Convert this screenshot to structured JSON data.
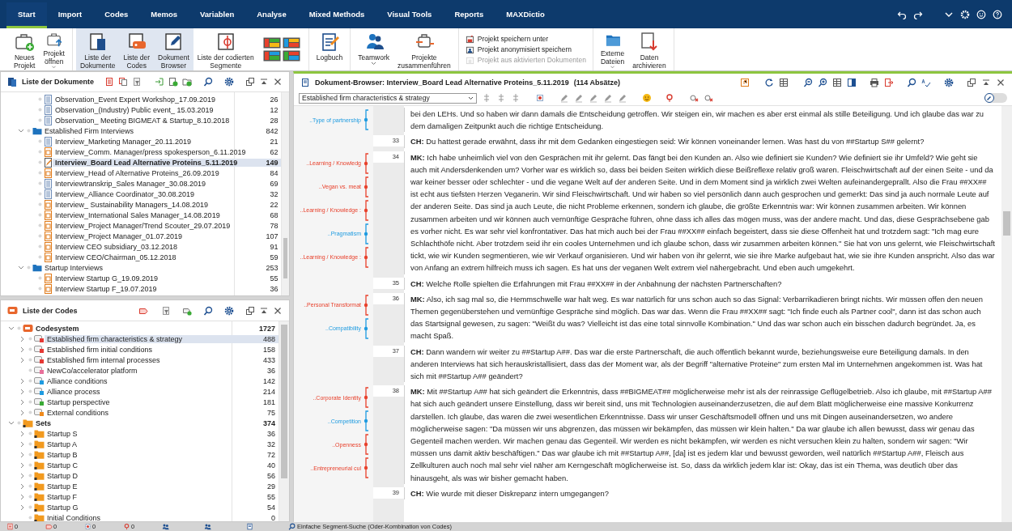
{
  "menu_tabs": [
    {
      "label": "Start",
      "selected": true
    },
    {
      "label": "Import",
      "selected": false
    },
    {
      "label": "Codes",
      "selected": false
    },
    {
      "label": "Memos",
      "selected": false
    },
    {
      "label": "Variablen",
      "selected": false
    },
    {
      "label": "Analyse",
      "selected": false
    },
    {
      "label": "Mixed Methods",
      "selected": false
    },
    {
      "label": "Visual Tools",
      "selected": false
    },
    {
      "label": "Reports",
      "selected": false
    },
    {
      "label": "MAXDictio",
      "selected": false
    }
  ],
  "ribbon": [
    [
      {
        "kind": "large",
        "label": "Neues\nProjekt",
        "dropdown": false,
        "selected": false
      },
      {
        "kind": "large",
        "label": "Projekt\nöffnen",
        "dropdown": true,
        "selected": false
      }
    ],
    [
      {
        "kind": "large",
        "label": "Liste der\nDokumente",
        "dropdown": false,
        "selected": true
      },
      {
        "kind": "large",
        "label": "Liste der\nCodes",
        "dropdown": false,
        "selected": true
      },
      {
        "kind": "large",
        "label": "Dokument\nBrowser",
        "dropdown": false,
        "selected": true
      },
      {
        "kind": "large",
        "label": "Liste der codierten\nSegmente",
        "dropdown": false,
        "selected": false
      },
      {
        "kind": "layouts"
      }
    ],
    [
      {
        "kind": "large",
        "label": "Logbuch",
        "dropdown": false,
        "selected": false
      }
    ],
    [
      {
        "kind": "large",
        "label": "Teamwork",
        "dropdown": true,
        "selected": false
      },
      {
        "kind": "large",
        "label": "Projekte\nzusammenführen",
        "dropdown": false,
        "selected": false
      }
    ],
    [
      {
        "kind": "small",
        "label": "Projekt speichern unter",
        "disabled": false
      },
      {
        "kind": "small",
        "label": "Projekt anonymisiert speichern",
        "disabled": false
      },
      {
        "kind": "small",
        "label": "Projekt aus aktivierten Dokumenten",
        "disabled": true
      }
    ],
    [
      {
        "kind": "large",
        "label": "Externe\nDateien",
        "dropdown": true,
        "selected": false
      },
      {
        "kind": "large",
        "label": "Daten\narchivieren",
        "dropdown": false,
        "selected": false
      }
    ]
  ],
  "documents_panel": {
    "title": "Liste der Dokumente",
    "tree": [
      {
        "children": [
          {
            "name": "Observation_Event Expert Workshop_17.09.2019",
            "kind": "text",
            "count": "26",
            "selected": false
          },
          {
            "name": "Observation_(Industry) Public event_ 15.03.2019",
            "kind": "text",
            "count": "12",
            "selected": false
          },
          {
            "name": "Observation_ Meeting BIGMEAT & Startup_8.10.2018",
            "kind": "text",
            "count": "28",
            "selected": false
          }
        ]
      },
      {
        "name": "Established Firm Interviews",
        "kind": "folder",
        "count": "842",
        "expanded": true,
        "selected": false,
        "children": [
          {
            "name": "Interview_Marketing Manager_20.11.2019",
            "kind": "text",
            "count": "21",
            "selected": false
          },
          {
            "name": "Interview_Comm. Manager/press spokesperson_6.11.2019",
            "kind": "media",
            "count": "62",
            "selected": false
          },
          {
            "name": "Interview_Board Lead Alternative Proteins_5.11.2019",
            "kind": "open",
            "count": "149",
            "selected": true
          },
          {
            "name": "Interview_Head of Alternative Proteins_26.09.2019",
            "kind": "media",
            "count": "84",
            "selected": false
          },
          {
            "name": "Interviewtranskrip_Sales Manager_30.08.2019",
            "kind": "text",
            "count": "69",
            "selected": false
          },
          {
            "name": "Interview_Alliance Coordinator_30.08.2019",
            "kind": "text",
            "count": "32",
            "selected": false
          },
          {
            "name": "Interview_ Sustainability Managers_14.08.2019",
            "kind": "media",
            "count": "22",
            "selected": false
          },
          {
            "name": "Interview_International Sales Manager_14.08.2019",
            "kind": "media",
            "count": "68",
            "selected": false
          },
          {
            "name": "Interview_Project Manager/Trend Scouter_29.07.2019",
            "kind": "media",
            "count": "78",
            "selected": false
          },
          {
            "name": "Interview_Project Manager_01.07.2019",
            "kind": "media",
            "count": "107",
            "selected": false
          },
          {
            "name": "Interview CEO subsidiary_03.12.2018",
            "kind": "media",
            "count": "91",
            "selected": false
          },
          {
            "name": "Interview CEO/Chairman_05.12.2018",
            "kind": "media",
            "count": "59",
            "selected": false
          }
        ]
      },
      {
        "name": "Startup Interviews",
        "kind": "folder",
        "count": "253",
        "expanded": true,
        "selected": false,
        "children": [
          {
            "name": "Interview Startup G_19.09.2019",
            "kind": "media",
            "count": "55",
            "selected": false
          },
          {
            "name": "Interview Startup F_19.07.2019",
            "kind": "media",
            "count": "36",
            "selected": false
          }
        ]
      }
    ]
  },
  "codes_panel": {
    "title": "Liste der Codes",
    "tree": [
      {
        "name": "Codesystem",
        "kind": "root",
        "count": "1727",
        "expanded": true,
        "selected": false,
        "children": [
          {
            "name": "Established firm characteristics & strategy",
            "kind": "code",
            "color": "#e53935",
            "count": "488",
            "expandable": true,
            "selected": true
          },
          {
            "name": "Established firm initial conditions",
            "kind": "code",
            "color": "#e53935",
            "count": "158",
            "expandable": true,
            "selected": false
          },
          {
            "name": "Established firm internal processes",
            "kind": "code",
            "color": "#e53935",
            "count": "433",
            "expandable": true,
            "selected": false
          },
          {
            "name": "NewCo/accelerator platform",
            "kind": "code",
            "color": "#e8709a",
            "count": "36",
            "expandable": false,
            "selected": false
          },
          {
            "name": "Alliance conditions",
            "kind": "code",
            "color": "#1e9be0",
            "count": "142",
            "expandable": true,
            "selected": false
          },
          {
            "name": "Alliance process",
            "kind": "code",
            "color": "#1e9be0",
            "count": "214",
            "expandable": true,
            "selected": false
          },
          {
            "name": "Startup perspective",
            "kind": "code",
            "color": "#3aaa35",
            "count": "181",
            "expandable": true,
            "selected": false
          },
          {
            "name": "External conditions",
            "kind": "code",
            "color": "#f08a1c",
            "count": "75",
            "expandable": true,
            "selected": false
          }
        ]
      },
      {
        "name": "Sets",
        "kind": "sets",
        "count": "374",
        "expanded": true,
        "selected": false,
        "children": [
          {
            "name": "Startup S",
            "kind": "set",
            "count": "36",
            "expandable": true,
            "selected": false
          },
          {
            "name": "Startup A",
            "kind": "set",
            "count": "32",
            "expandable": true,
            "selected": false
          },
          {
            "name": "Startup B",
            "kind": "set",
            "count": "72",
            "expandable": true,
            "selected": false
          },
          {
            "name": "Startup C",
            "kind": "set",
            "count": "40",
            "expandable": true,
            "selected": false
          },
          {
            "name": "Startup D",
            "kind": "set",
            "count": "56",
            "expandable": true,
            "selected": false
          },
          {
            "name": "Startup E",
            "kind": "set",
            "count": "29",
            "expandable": true,
            "selected": false
          },
          {
            "name": "Startup F",
            "kind": "set",
            "count": "55",
            "expandable": true,
            "selected": false
          },
          {
            "name": "Startup G",
            "kind": "set",
            "count": "54",
            "expandable": true,
            "selected": false
          },
          {
            "name": "Initial Conditions",
            "kind": "set",
            "count": "0",
            "expandable": false,
            "selected": false
          }
        ]
      }
    ]
  },
  "browser": {
    "title": "Dokument-Browser: Interview_Board Lead Alternative Proteins_5.11.2019",
    "paragraph_count": "(114 Absätze)",
    "code_filter": "Established firm characteristics & strategy",
    "paragraphs": [
      {
        "text": "bei den LEHs. Und so haben wir dann damals die Entscheidung getroffen. Wir steigen ein, wir machen es aber erst einmal als stille Beteiligung. Und ich glaube das war zu dem damaligen Zeitpunkt auch die richtige Entscheidung.",
        "codes": [
          {
            "label": "..Type of partnership",
            "color": "#1e9be0"
          }
        ]
      },
      {
        "number": "33",
        "text": "**CH:** Du hattest gerade erwähnt, dass ihr mit dem Gedanken eingestiegen seid: Wir können voneinander lernen. Was hast du von ##Startup S## gelernt?"
      },
      {
        "number": "34",
        "text": "**MK:** Ich habe unheimlich viel von den Gesprächen mit ihr gelernt. Das fängt bei den Kunden an. Also wie definiert sie Kunden? Wie definiert sie ihr Umfeld? Wie geht sie auch mit Andersdenkenden um? Vorher war es wirklich so, dass bei beiden Seiten wirklich diese Beißreflexe relativ groß waren. Fleischwirtschaft auf der einen Seite - und da war keiner besser oder schlechter - und die vegane Welt auf der anderen Seite. Und in dem Moment sind ja wirklich zwei Welten aufeinandergeprallt. Also die Frau ##XX## ist echt aus tiefsten Herzen Veganerin. Wir sind Fleischwirtschaft. Und wir haben so viel persönlich dann auch gesprochen und gemerkt: Das sind ja auch normale Leute auf der anderen Seite. Das sind ja auch Leute, die nicht Probleme erkennen, sondern ich glaube, die größte Erkenntnis war: Wir können zusammen arbeiten. Wir können zusammen arbeiten und wir können auch vernünftige Gespräche führen, ohne dass ich alles das mögen muss, was der andere macht. Und das, diese Gesprächsebene gab es vorher nicht. Es war sehr viel konfrontativer. Das hat mich auch bei der Frau ##XX## einfach begeistert, dass sie diese Offenheit hat und trotzdem sagt: \"Ich mag eure Schlachthöfe nicht. Aber trotzdem seid ihr ein cooles Unternehmen und ich glaube schon, dass wir zusammen arbeiten können.\" Sie hat von uns gelernt, wie Fleischwirtschaft tickt, wie wir Kunden segmentieren, wie wir Verkauf organisieren. Und wir haben von ihr gelernt, wie sie ihre Marke aufgebaut hat, wie sie ihre Kunden anspricht. Also das war von Anfang an extrem hilfreich muss ich sagen. Es hat uns der veganen Welt extrem viel nähergebracht. Und eben auch umgekehrt.",
        "codes": [
          {
            "label": "..Learning / Knowledg",
            "color": "#e8412c"
          },
          {
            "label": "..Vegan vs. meat",
            "color": "#e8412c"
          },
          {
            "label": "..Learning / Knowledge :",
            "color": "#e8412c"
          },
          {
            "label": "..Pragmatism",
            "color": "#1e9be0"
          },
          {
            "label": "..Learning / Knowledge :",
            "color": "#e8412c"
          }
        ]
      },
      {
        "number": "35",
        "text": "**CH:** Welche Rolle spielten die Erfahrungen mit Frau ##XX## in der Anbahnung der nächsten Partnerschaften?"
      },
      {
        "number": "36",
        "text": "**MK:** Also, ich sag mal so, die Hemmschwelle war halt weg. Es war natürlich für uns schon auch so das Signal: Verbarrikadieren bringt nichts. Wir müssen offen den neuen Themen gegenüberstehen und vernünftige Gespräche sind möglich. Das war das. Wenn die Frau ##XX## sagt: \"Ich finde euch als Partner cool\", dann ist das schon auch das Startsignal gewesen, zu sagen: \"Weißt du was? Vielleicht ist das eine total sinnvolle Kombination.\" Und das war schon auch ein bisschen dadurch begründet. Ja, es macht Spaß.",
        "codes": [
          {
            "label": "..Personal Transformat",
            "color": "#e8412c"
          },
          {
            "label": "..Compatibility",
            "color": "#1e9be0"
          }
        ]
      },
      {
        "number": "37",
        "text": "**CH:** Dann wandern wir weiter zu ##Startup A##. Das war die erste Partnerschaft, die auch öffentlich bekannt wurde, beziehungsweise eure Beteiligung damals. In den anderen Interviews hat sich herauskristallisiert, dass das der Moment war, als der Begriff \"alternative Proteine\" zum ersten Mal im Unternehmen angekommen ist. Was hat sich mit ##Startup A## geändert?"
      },
      {
        "number": "38",
        "text": "**MK:** Mit ##Startup A## hat sich geändert die Erkenntnis, dass ##BIGMEAT## möglicherweise mehr ist als der reinrassige Geflügelbetrieb. Also ich glaube, mit ##Startup A## hat sich auch geändert unsere Einstellung, dass wir bereit sind, uns mit Technologien auseinanderzusetzen, die auf dem Blatt möglicherweise eine massive Konkurrenz darstellen. Ich glaube, das waren die zwei wesentlichen Erkenntnisse. Dass wir unser Geschäftsmodell öffnen und uns mit Dingen auseinandersetzen, wo andere möglicherweise sagen: \"Da müssen wir uns abgrenzen, das müssen wir bekämpfen, das müssen wir klein halten.\" Da war glaube ich allen bewusst, dass wir genau das Gegenteil machen werden. Wir machen genau das Gegenteil. Wir werden es nicht bekämpfen, wir werden es nicht versuchen klein zu halten, sondern wir sagen: \"Wir müssen uns damit aktiv beschäftigen.\" Das war glaube ich mit ##Startup A##, [da] ist es jedem klar und bewusst geworden, weil natürlich ##Startup A##, Fleisch aus Zellkulturen auch noch mal sehr viel näher am Kerngeschäft möglicherweise ist. So, dass da wirklich jedem klar ist: Okay, das ist ein Thema, was deutlich über das hinausgeht, als was wir bisher gemacht haben.",
        "codes": [
          {
            "label": "..Corporate Identity",
            "color": "#e8412c"
          },
          {
            "label": "..Competition",
            "color": "#1e9be0"
          },
          {
            "label": "..Openness",
            "color": "#e8412c"
          },
          {
            "label": "..Entrepreneurial cul",
            "color": "#e8412c"
          }
        ]
      },
      {
        "number": "39",
        "text": "**CH:** Wie wurde mit dieser Diskrepanz intern umgegangen?"
      }
    ]
  },
  "status_counts": [
    "0",
    "0",
    "0",
    "0"
  ],
  "status_text": "Einfache Segment-Suche (Oder-Kombination von Codes)"
}
